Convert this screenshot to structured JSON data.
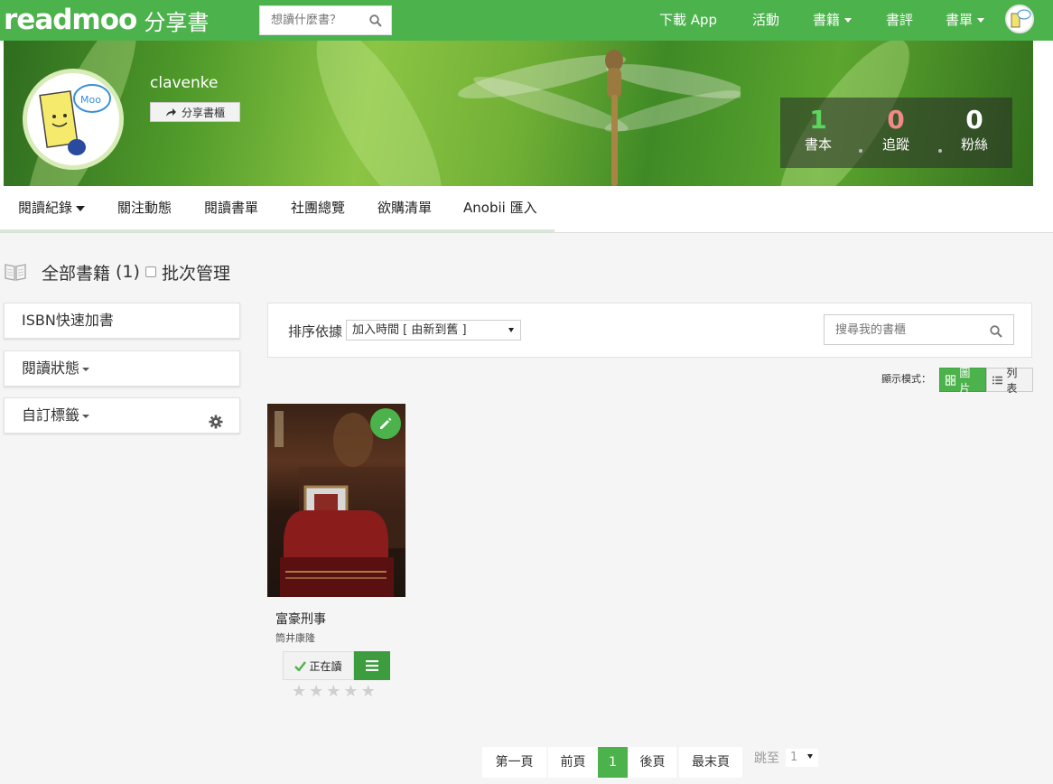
{
  "brand": {
    "logo_text": "readmoo",
    "logo_sub": "分享書"
  },
  "topnav": {
    "search_placeholder": "想讀什麼書？",
    "items": [
      "下載 App",
      "活動",
      "書籍",
      "書評",
      "書單"
    ]
  },
  "profile": {
    "username": "clavenke",
    "share_label": "分享書櫃",
    "avatar_bubble": "Moo",
    "stats": [
      {
        "value": "1",
        "label": "書本",
        "color": "#5cd65c"
      },
      {
        "value": "0",
        "label": "追蹤",
        "color": "#f08a8a"
      },
      {
        "value": "0",
        "label": "粉絲",
        "color": "#ffffff"
      }
    ]
  },
  "subnav": {
    "items": [
      "閱讀紀錄",
      "關注動態",
      "閱讀書單",
      "社團總覽",
      "欲購清單",
      "Anobii 匯入"
    ]
  },
  "heading": {
    "title": "全部書籍",
    "count": "(1)",
    "batch_label": "批次管理"
  },
  "sidebar": {
    "isbn_label": "ISBN快速加書",
    "status_label": "閱讀狀態",
    "tags_label": "自訂標籤"
  },
  "toolbar": {
    "sort_label": "排序依據",
    "sort_value": "加入時間 [ 由新到舊 ]",
    "search_placeholder": "搜尋我的書櫃",
    "view_mode_label": "顯示模式：",
    "view_grid": "圖片",
    "view_list": "列表"
  },
  "book": {
    "title": "富豪刑事",
    "author": "筒井康隆",
    "status": "正在讀",
    "rating": 0,
    "max_rating": 5
  },
  "pagination": {
    "first": "第一頁",
    "prev": "前頁",
    "current": "1",
    "next": "後頁",
    "last": "最末頁",
    "jump_label": "跳至",
    "jump_value": "1"
  },
  "colors": {
    "brand_green": "#4cb24c"
  }
}
